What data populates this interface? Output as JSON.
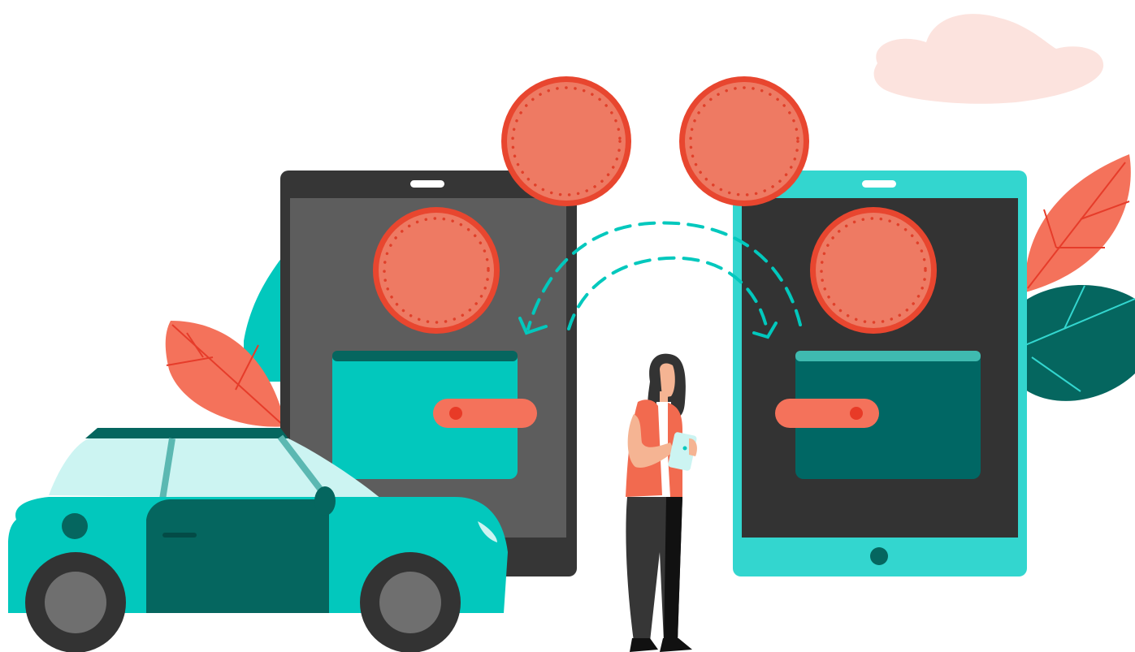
{
  "scene": {
    "description_elements": [
      "cloud",
      "leaves",
      "left-tablet",
      "right-tablet",
      "coins",
      "wallets",
      "transfer-arrows",
      "woman",
      "car"
    ]
  },
  "colors": {
    "coin_fill": "#EE7A63",
    "coin_ring": "#E8462F",
    "coin_dots": "#E0402A",
    "teal": "#02C8BD",
    "teal_light": "#33D6CF",
    "teal_dark": "#05665F",
    "wallet_dark": "#006764",
    "tablet_dark_frame": "#363636",
    "tablet_dark_screen": "#5D5D5D",
    "tablet_right_screen": "#333333",
    "leaf_orange": "#F4725B",
    "leaf_vein": "#E63C2A",
    "cloud": "#FCE3DE",
    "strap": "#F4725B",
    "strap_dot": "#E83A27",
    "car_glass": "#CCF4F2",
    "tire": "#333333",
    "rim": "#6F6F6F",
    "skin": "#F5B493",
    "hair": "#333333",
    "vest": "#F26A4F",
    "pants": "#363636"
  },
  "icons": {
    "coin": "coin-icon",
    "wallet": "wallet-icon",
    "arrow": "curved-arrow-icon"
  }
}
